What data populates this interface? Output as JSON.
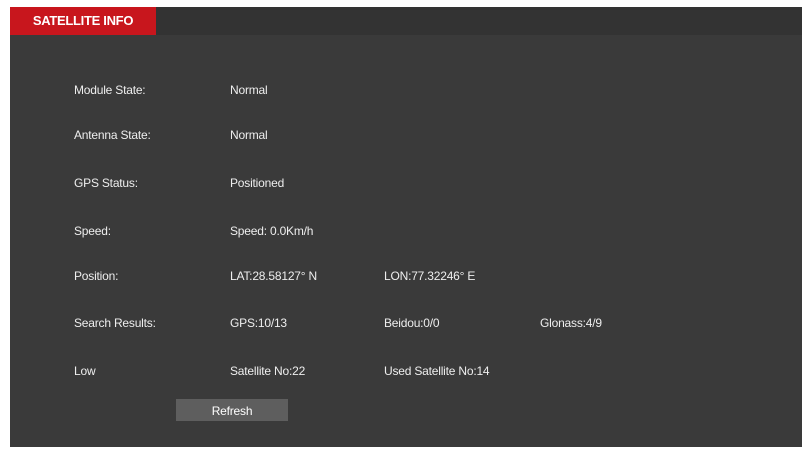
{
  "tab": {
    "label": "SATELLITE INFO"
  },
  "rows": {
    "module_state": {
      "label": "Module State:",
      "value": "Normal"
    },
    "antenna_state": {
      "label": "Antenna State:",
      "value": "Normal"
    },
    "gps_status": {
      "label": "GPS Status:",
      "value": "Positioned"
    },
    "speed": {
      "label": "Speed:",
      "value": "Speed: 0.0Km/h"
    },
    "position": {
      "label": "Position:",
      "lat": "LAT:28.58127° N",
      "lon": "LON:77.32246° E"
    },
    "search_results": {
      "label": "Search Results:",
      "gps": "GPS:10/13",
      "beidou": "Beidou:0/0",
      "glonass": "Glonass:4/9"
    },
    "satellites": {
      "label": "Low",
      "satellite_no": "Satellite No:22",
      "used_satellite_no": "Used Satellite No:14"
    }
  },
  "refresh_button": {
    "label": "Refresh"
  },
  "colors": {
    "accent": "#c8161d",
    "panel_bg": "#3a3a3a",
    "button_bg": "#5e5e5e"
  }
}
